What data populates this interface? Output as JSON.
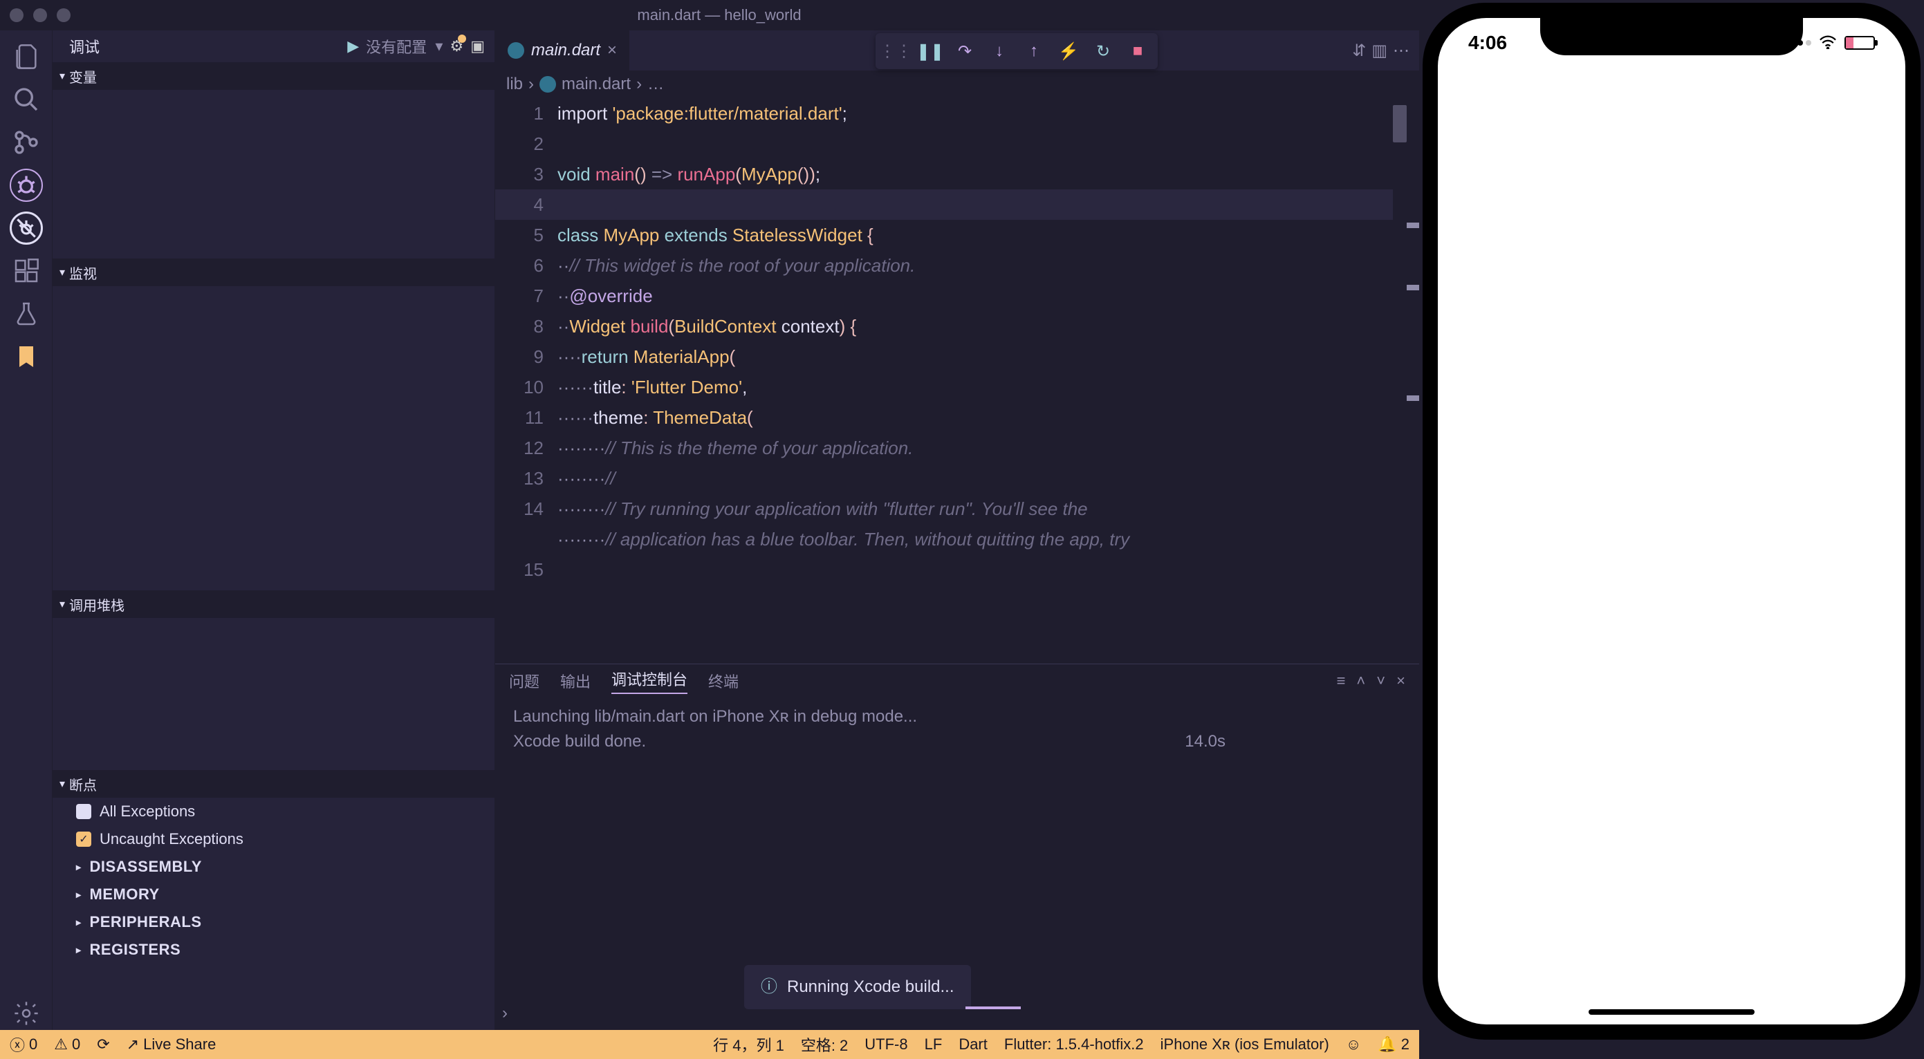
{
  "window": {
    "title": "main.dart — hello_world"
  },
  "activity": {
    "files": "files-icon",
    "search": "search-icon",
    "scm": "git-branch-icon",
    "debug": "bug-icon",
    "debug2": "no-bugs-icon",
    "ext": "extensions-icon",
    "flask": "flask-icon",
    "bookmark": "bookmark-icon",
    "settings": "gear-icon"
  },
  "debugBar": {
    "label": "调试",
    "play": "▶",
    "config": "没有配置",
    "gear": "⚙",
    "console": "▢"
  },
  "sections": {
    "variables": "变量",
    "watch": "监视",
    "callstack": "调用堆栈",
    "breakpoints": "断点",
    "allExceptions": "All Exceptions",
    "uncaughtExceptions": "Uncaught Exceptions",
    "disassembly": "DISASSEMBLY",
    "memory": "MEMORY",
    "peripherals": "PERIPHERALS",
    "registers": "REGISTERS"
  },
  "tab": {
    "filename": "main.dart"
  },
  "breadcrumb": {
    "lib": "lib",
    "file": "main.dart",
    "more": "…"
  },
  "debugFloat": {
    "handle": "⋮⋮",
    "pause": "❚❚",
    "stepOver": "↷",
    "stepInto": "↓",
    "stepOut": "↑",
    "hot": "⚡",
    "restart": "↻",
    "stop": "■"
  },
  "tabsRight": {
    "compare": "⇵",
    "split": "▥",
    "more": "⋯"
  },
  "code": {
    "lines": [
      {
        "n": 1,
        "segs": [
          [
            "name",
            "import "
          ],
          [
            "str",
            "'package:flutter/material.dart'"
          ],
          [
            "name",
            ";"
          ]
        ]
      },
      {
        "n": 2,
        "segs": [
          [
            "name",
            ""
          ]
        ]
      },
      {
        "n": 3,
        "segs": [
          [
            "kw",
            "void "
          ],
          [
            "fn",
            "main"
          ],
          [
            "pun",
            "() "
          ],
          [
            "p",
            "=>"
          ],
          [
            "name",
            " "
          ],
          [
            "fn",
            "runApp"
          ],
          [
            "pun",
            "("
          ],
          [
            "cls",
            "MyApp"
          ],
          [
            "pun",
            "())"
          ],
          [
            "name",
            ";"
          ]
        ]
      },
      {
        "n": 4,
        "segs": [
          [
            "name",
            ""
          ]
        ]
      },
      {
        "n": 5,
        "segs": [
          [
            "kw",
            "class "
          ],
          [
            "cls",
            "MyApp "
          ],
          [
            "kw",
            "extends "
          ],
          [
            "cls",
            "StatelessWidget "
          ],
          [
            "pun",
            "{"
          ]
        ]
      },
      {
        "n": 6,
        "segs": [
          [
            "p",
            "··"
          ],
          [
            "cm",
            "// This widget is the root of your application."
          ]
        ]
      },
      {
        "n": 7,
        "segs": [
          [
            "p",
            "··"
          ],
          [
            "an",
            "@override"
          ]
        ]
      },
      {
        "n": 8,
        "segs": [
          [
            "p",
            "··"
          ],
          [
            "cls",
            "Widget "
          ],
          [
            "fn",
            "build"
          ],
          [
            "pun",
            "("
          ],
          [
            "cls",
            "BuildContext "
          ],
          [
            "name",
            "context"
          ],
          [
            "pun",
            ") {"
          ]
        ]
      },
      {
        "n": 9,
        "segs": [
          [
            "p",
            "····"
          ],
          [
            "kw",
            "return "
          ],
          [
            "cls",
            "MaterialApp"
          ],
          [
            "pun",
            "("
          ]
        ]
      },
      {
        "n": 10,
        "segs": [
          [
            "p",
            "······"
          ],
          [
            "name",
            "title"
          ],
          [
            "pun",
            ": "
          ],
          [
            "str",
            "'Flutter Demo'"
          ],
          [
            "name",
            ","
          ]
        ]
      },
      {
        "n": 11,
        "segs": [
          [
            "p",
            "······"
          ],
          [
            "name",
            "theme"
          ],
          [
            "pun",
            ": "
          ],
          [
            "cls",
            "ThemeData"
          ],
          [
            "pun",
            "("
          ]
        ]
      },
      {
        "n": 12,
        "segs": [
          [
            "p",
            "········"
          ],
          [
            "cm",
            "// This is the theme of your application."
          ]
        ]
      },
      {
        "n": 13,
        "segs": [
          [
            "p",
            "········"
          ],
          [
            "cm",
            "//"
          ]
        ]
      },
      {
        "n": 14,
        "segs": [
          [
            "p",
            "········"
          ],
          [
            "cm",
            "// Try running your application with \"flutter run\". You'll see the"
          ]
        ]
      },
      {
        "n": 15,
        "segs": [
          [
            "p",
            "········"
          ],
          [
            "cm",
            "// application has a blue toolbar. Then, without quitting the app, try"
          ]
        ]
      }
    ]
  },
  "panel": {
    "tabs": {
      "problems": "问题",
      "output": "输出",
      "debugConsole": "调试控制台",
      "terminal": "终端"
    },
    "line1": "Launching lib/main.dart on iPhone Xʀ in debug mode...",
    "line2": "Xcode build done.",
    "time": "14.0s",
    "prompt": "›"
  },
  "toast": {
    "icon": "ⓘ",
    "text": "Running Xcode build..."
  },
  "status": {
    "errors": "0",
    "warnings": "0",
    "liveShare": "Live Share",
    "cursor": "行 4，列 1",
    "spaces": "空格: 2",
    "encoding": "UTF-8",
    "eol": "LF",
    "lang": "Dart",
    "flutter": "Flutter: 1.5.4-hotfix.2",
    "device": "iPhone Xʀ (ios Emulator)",
    "bell": "2"
  },
  "phone": {
    "time": "4:06",
    "wifi": "wifi-icon"
  }
}
